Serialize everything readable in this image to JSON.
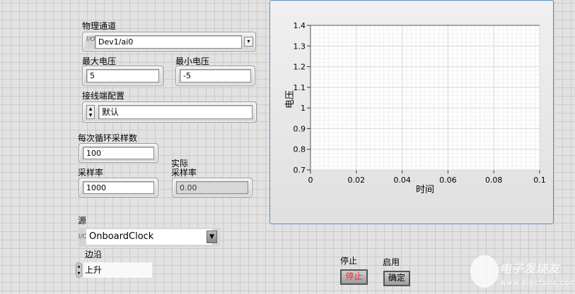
{
  "controls": {
    "physical_channel": {
      "label": "物理通道",
      "value": "Dev1/ai0",
      "io_icon": "I/O"
    },
    "max_voltage": {
      "label": "最大电压",
      "value": "5"
    },
    "min_voltage": {
      "label": "最小电压",
      "value": "-5"
    },
    "terminal_config": {
      "label": "接线端配置",
      "value": "默认"
    },
    "samples_per_loop": {
      "label": "每次循环采样数",
      "value": "100"
    },
    "sample_rate": {
      "label": "采样率",
      "value": "1000"
    },
    "actual_sample_rate": {
      "label_line1": "实际",
      "label_line2": "采样率",
      "value": "0.00"
    },
    "source": {
      "label": "源",
      "value": "OnboardClock",
      "io_icon": "I/O"
    },
    "edge": {
      "label": "边沿",
      "value": "上升"
    },
    "stop": {
      "label": "停止",
      "button_text": "停止"
    },
    "enable": {
      "label": "启用",
      "button_text": "确定"
    }
  },
  "colors": {
    "stop_text": "#ff2020",
    "graph_border": "#5b8fbf"
  },
  "chart_data": {
    "type": "line",
    "xlabel": "时间",
    "ylabel": "电压",
    "xlim": [
      0,
      0.1
    ],
    "ylim": [
      0.7,
      1.4
    ],
    "xticks": [
      "0",
      "0.02",
      "0.04",
      "0.06",
      "0.08",
      "0.1"
    ],
    "yticks": [
      "1.4",
      "1.3",
      "1.2",
      "1.1",
      "1",
      "0.9",
      "0.8",
      "0.7"
    ],
    "grid": true,
    "series": []
  },
  "watermark": {
    "text": "电子发烧友",
    "url": "www.elecfans.com"
  }
}
